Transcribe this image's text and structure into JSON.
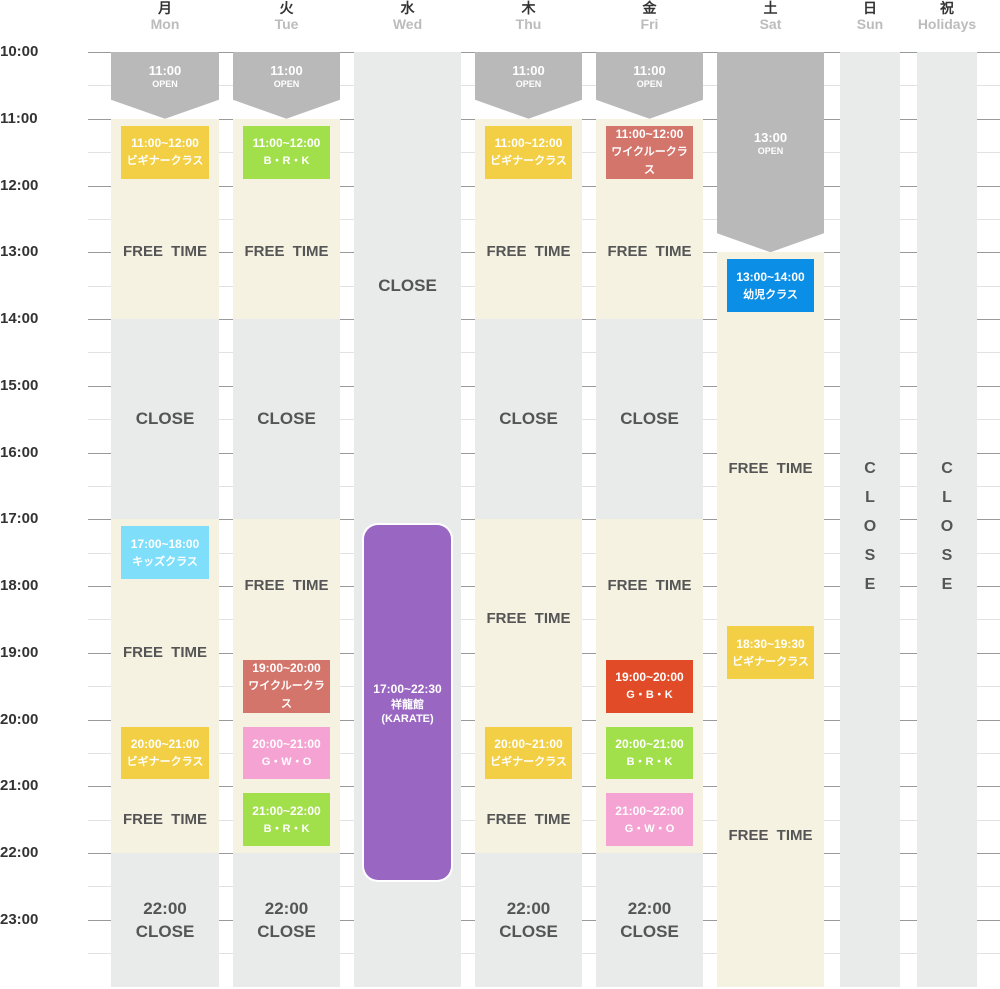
{
  "times": [
    "10:00",
    "11:00",
    "12:00",
    "13:00",
    "14:00",
    "15:00",
    "16:00",
    "17:00",
    "18:00",
    "19:00",
    "20:00",
    "21:00",
    "22:00",
    "23:00"
  ],
  "days": [
    {
      "jp": "月",
      "en": "Mon",
      "zones": [
        {
          "type": "open",
          "start": "10:00",
          "end": "11:00",
          "time": "11:00",
          "label": "OPEN"
        },
        {
          "type": "free",
          "start": "11:00",
          "end": "14:00"
        },
        {
          "type": "closed",
          "start": "14:00",
          "end": "17:00",
          "label": "CLOSE"
        },
        {
          "type": "free",
          "start": "17:00",
          "end": "22:00"
        },
        {
          "type": "closed",
          "start": "22:00",
          "end": "24:00",
          "label": "22:00\nCLOSE"
        }
      ],
      "free_time": [
        {
          "start": "12:00",
          "end": "14:00",
          "label": "FREE TIME"
        },
        {
          "start": "18:00",
          "end": "20:00",
          "label": "FREE TIME"
        },
        {
          "start": "21:00",
          "end": "22:00",
          "label": "FREE TIME"
        }
      ],
      "classes": [
        {
          "time": "11:00~12:00",
          "name": "ビギナークラス",
          "color": "#f2cf44"
        },
        {
          "time": "17:00~18:00",
          "name": "キッズクラス",
          "color": "#7fdffa"
        },
        {
          "time": "20:00~21:00",
          "name": "ビギナークラス",
          "color": "#f2cf44"
        }
      ]
    },
    {
      "jp": "火",
      "en": "Tue",
      "zones": [
        {
          "type": "open",
          "start": "10:00",
          "end": "11:00",
          "time": "11:00",
          "label": "OPEN"
        },
        {
          "type": "free",
          "start": "11:00",
          "end": "14:00"
        },
        {
          "type": "closed",
          "start": "14:00",
          "end": "17:00",
          "label": "CLOSE"
        },
        {
          "type": "free",
          "start": "17:00",
          "end": "22:00"
        },
        {
          "type": "closed",
          "start": "22:00",
          "end": "24:00",
          "label": "22:00\nCLOSE"
        }
      ],
      "free_time": [
        {
          "start": "12:00",
          "end": "14:00",
          "label": "FREE TIME"
        },
        {
          "start": "17:00",
          "end": "19:00",
          "label": "FREE TIME"
        }
      ],
      "classes": [
        {
          "time": "11:00~12:00",
          "name": "B・R・K",
          "color": "#a2e04b"
        },
        {
          "time": "19:00~20:00",
          "name": "ワイクルークラス",
          "color": "#d4756c"
        },
        {
          "time": "20:00~21:00",
          "name": "G・W・O",
          "color": "#f5a3d3"
        },
        {
          "time": "21:00~22:00",
          "name": "B・R・K",
          "color": "#a2e04b"
        }
      ]
    },
    {
      "jp": "水",
      "en": "Wed",
      "zones": [
        {
          "type": "closed",
          "start": "10:00",
          "end": "17:00",
          "label": "CLOSE"
        },
        {
          "type": "closed",
          "start": "17:00",
          "end": "24:00"
        }
      ],
      "free_time": [],
      "classes": [
        {
          "time": "17:00~22:30",
          "name": "祥龍館\n(KARATE)",
          "color": "#9966c2",
          "rounded": true
        }
      ]
    },
    {
      "jp": "木",
      "en": "Thu",
      "zones": [
        {
          "type": "open",
          "start": "10:00",
          "end": "11:00",
          "time": "11:00",
          "label": "OPEN"
        },
        {
          "type": "free",
          "start": "11:00",
          "end": "14:00"
        },
        {
          "type": "closed",
          "start": "14:00",
          "end": "17:00",
          "label": "CLOSE"
        },
        {
          "type": "free",
          "start": "17:00",
          "end": "22:00"
        },
        {
          "type": "closed",
          "start": "22:00",
          "end": "24:00",
          "label": "22:00\nCLOSE"
        }
      ],
      "free_time": [
        {
          "start": "12:00",
          "end": "14:00",
          "label": "FREE TIME"
        },
        {
          "start": "17:00",
          "end": "20:00",
          "label": "FREE TIME"
        },
        {
          "start": "21:00",
          "end": "22:00",
          "label": "FREE TIME"
        }
      ],
      "classes": [
        {
          "time": "11:00~12:00",
          "name": "ビギナークラス",
          "color": "#f2cf44"
        },
        {
          "time": "20:00~21:00",
          "name": "ビギナークラス",
          "color": "#f2cf44"
        }
      ]
    },
    {
      "jp": "金",
      "en": "Fri",
      "zones": [
        {
          "type": "open",
          "start": "10:00",
          "end": "11:00",
          "time": "11:00",
          "label": "OPEN"
        },
        {
          "type": "free",
          "start": "11:00",
          "end": "14:00"
        },
        {
          "type": "closed",
          "start": "14:00",
          "end": "17:00",
          "label": "CLOSE"
        },
        {
          "type": "free",
          "start": "17:00",
          "end": "22:00"
        },
        {
          "type": "closed",
          "start": "22:00",
          "end": "24:00",
          "label": "22:00\nCLOSE"
        }
      ],
      "free_time": [
        {
          "start": "12:00",
          "end": "14:00",
          "label": "FREE TIME"
        },
        {
          "start": "17:00",
          "end": "19:00",
          "label": "FREE TIME"
        }
      ],
      "classes": [
        {
          "time": "11:00~12:00",
          "name": "ワイクルークラス",
          "color": "#d4756c"
        },
        {
          "time": "19:00~20:00",
          "name": "G・B・K",
          "color": "#e24b27"
        },
        {
          "time": "20:00~21:00",
          "name": "B・R・K",
          "color": "#a2e04b"
        },
        {
          "time": "21:00~22:00",
          "name": "G・W・O",
          "color": "#f5a3d3"
        }
      ]
    },
    {
      "jp": "土",
      "en": "Sat",
      "zones": [
        {
          "type": "open",
          "start": "10:00",
          "end": "13:00",
          "time": "13:00",
          "label": "OPEN"
        },
        {
          "type": "free",
          "start": "13:00",
          "end": "24:00"
        }
      ],
      "free_time": [
        {
          "start": "14:00",
          "end": "18:30",
          "label": "FREE TIME"
        },
        {
          "start": "19:30",
          "end": "24:00",
          "label": "FREE TIME"
        }
      ],
      "classes": [
        {
          "time": "13:00~14:00",
          "name": "幼児クラス",
          "color": "#0a8ee6"
        },
        {
          "time": "18:30~19:30",
          "name": "ビギナークラス",
          "color": "#f2cf44"
        }
      ]
    },
    {
      "jp": "日",
      "en": "Sun",
      "zones": [
        {
          "type": "closed",
          "start": "10:00",
          "end": "24:00",
          "vertical": "CLOSE"
        }
      ],
      "free_time": [],
      "classes": []
    },
    {
      "jp": "祝",
      "en": "Holidays",
      "zones": [
        {
          "type": "closed",
          "start": "10:00",
          "end": "24:00",
          "vertical": "CLOSE"
        }
      ],
      "free_time": [],
      "classes": []
    }
  ]
}
